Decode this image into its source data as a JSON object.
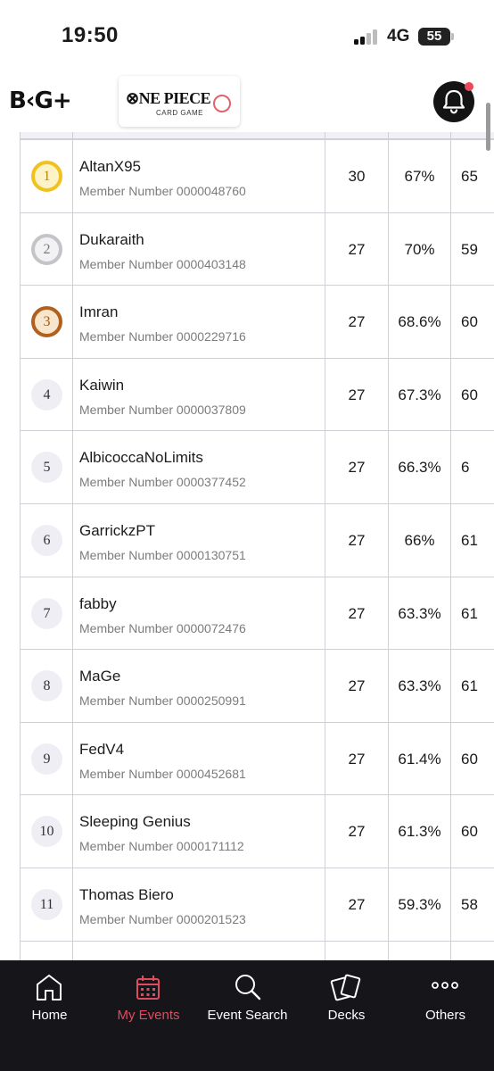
{
  "status_bar": {
    "time": "19:50",
    "network": "4G",
    "battery": "55"
  },
  "header": {
    "app_logo": "B‹G+",
    "game_logo_main": "⊗NE PIECE",
    "game_logo_sub": "CARD GAME",
    "notification_icon": "bell-icon",
    "accent_color": "#e04c5f"
  },
  "standings": [
    {
      "rank": "1",
      "medal": "gold",
      "name": "AltanX95",
      "member": "Member Number 0000048760",
      "points": "30",
      "win_pct": "67%",
      "extra": "65"
    },
    {
      "rank": "2",
      "medal": "silver",
      "name": "Dukaraith",
      "member": "Member Number 0000403148",
      "points": "27",
      "win_pct": "70%",
      "extra": "59"
    },
    {
      "rank": "3",
      "medal": "bronze",
      "name": "Imran",
      "member": "Member Number 0000229716",
      "points": "27",
      "win_pct": "68.6%",
      "extra": "60"
    },
    {
      "rank": "4",
      "medal": "plain",
      "name": "Kaiwin",
      "member": "Member Number 0000037809",
      "points": "27",
      "win_pct": "67.3%",
      "extra": "60"
    },
    {
      "rank": "5",
      "medal": "plain",
      "name": "AlbicoccaNoLimits",
      "member": "Member Number 0000377452",
      "points": "27",
      "win_pct": "66.3%",
      "extra": "6"
    },
    {
      "rank": "6",
      "medal": "plain",
      "name": "GarrickzPT",
      "member": "Member Number 0000130751",
      "points": "27",
      "win_pct": "66%",
      "extra": "61"
    },
    {
      "rank": "7",
      "medal": "plain",
      "name": "fabby",
      "member": "Member Number 0000072476",
      "points": "27",
      "win_pct": "63.3%",
      "extra": "61"
    },
    {
      "rank": "8",
      "medal": "plain",
      "name": "MaGe",
      "member": "Member Number 0000250991",
      "points": "27",
      "win_pct": "63.3%",
      "extra": "61"
    },
    {
      "rank": "9",
      "medal": "plain",
      "name": "FedV4",
      "member": "Member Number 0000452681",
      "points": "27",
      "win_pct": "61.4%",
      "extra": "60"
    },
    {
      "rank": "10",
      "medal": "plain",
      "name": "Sleeping Genius",
      "member": "Member Number 0000171112",
      "points": "27",
      "win_pct": "61.3%",
      "extra": "60"
    },
    {
      "rank": "11",
      "medal": "plain",
      "name": "Thomas Biero",
      "member": "Member Number 0000201523",
      "points": "27",
      "win_pct": "59.3%",
      "extra": "58"
    }
  ],
  "bottom_nav": [
    {
      "label": "Home",
      "icon": "home-icon",
      "active": false
    },
    {
      "label": "My Events",
      "icon": "calendar-icon",
      "active": true
    },
    {
      "label": "Event Search",
      "icon": "search-icon",
      "active": false
    },
    {
      "label": "Decks",
      "icon": "cards-icon",
      "active": false
    },
    {
      "label": "Others",
      "icon": "more-icon",
      "active": false
    }
  ]
}
